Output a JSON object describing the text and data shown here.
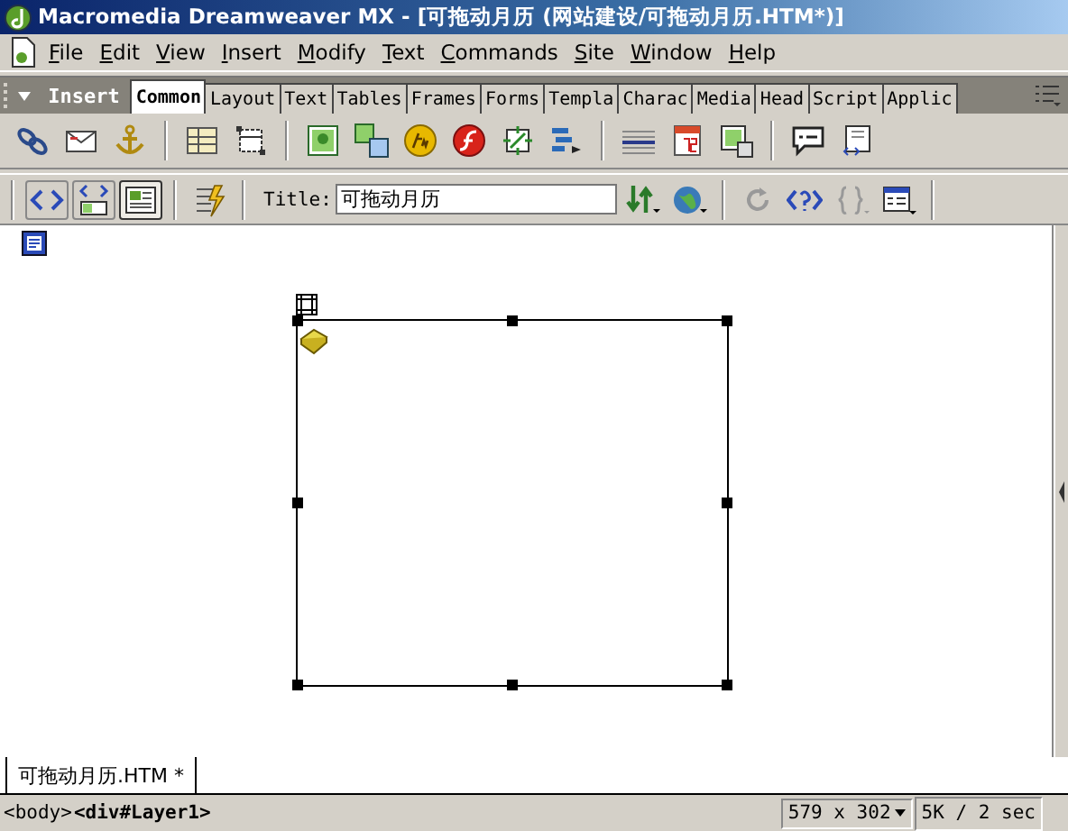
{
  "window": {
    "title": "Macromedia Dreamweaver MX - [可拖动月历 (网站建设/可拖动月历.HTM*)]"
  },
  "menu": [
    "File",
    "Edit",
    "View",
    "Insert",
    "Modify",
    "Text",
    "Commands",
    "Site",
    "Window",
    "Help"
  ],
  "insert_bar": {
    "title": "Insert",
    "expanded": true,
    "tabs": [
      {
        "label": "Common",
        "selected": true
      },
      {
        "label": "Layout",
        "selected": false
      },
      {
        "label": "Text",
        "selected": false
      },
      {
        "label": "Tables",
        "selected": false
      },
      {
        "label": "Frames",
        "selected": false
      },
      {
        "label": "Forms",
        "selected": false
      },
      {
        "label": "Templa",
        "selected": false
      },
      {
        "label": "Charac",
        "selected": false
      },
      {
        "label": "Media",
        "selected": false
      },
      {
        "label": "Head",
        "selected": false
      },
      {
        "label": "Script",
        "selected": false
      },
      {
        "label": "Applic",
        "selected": false
      }
    ]
  },
  "document_toolbar": {
    "views": [
      {
        "selected": false
      },
      {
        "selected": false
      },
      {
        "selected": true
      }
    ],
    "title_label": "Title:",
    "title_value": "可拖动月历"
  },
  "document_tabs": [
    {
      "label": "可拖动月历.HTM *",
      "selected": true
    }
  ],
  "status_bar": {
    "tags": [
      {
        "label": "<body>",
        "selected": false
      },
      {
        "label": "<div#Layer1>",
        "selected": true
      }
    ],
    "window_size": "579 x 302",
    "download": "5K / 2 sec"
  }
}
